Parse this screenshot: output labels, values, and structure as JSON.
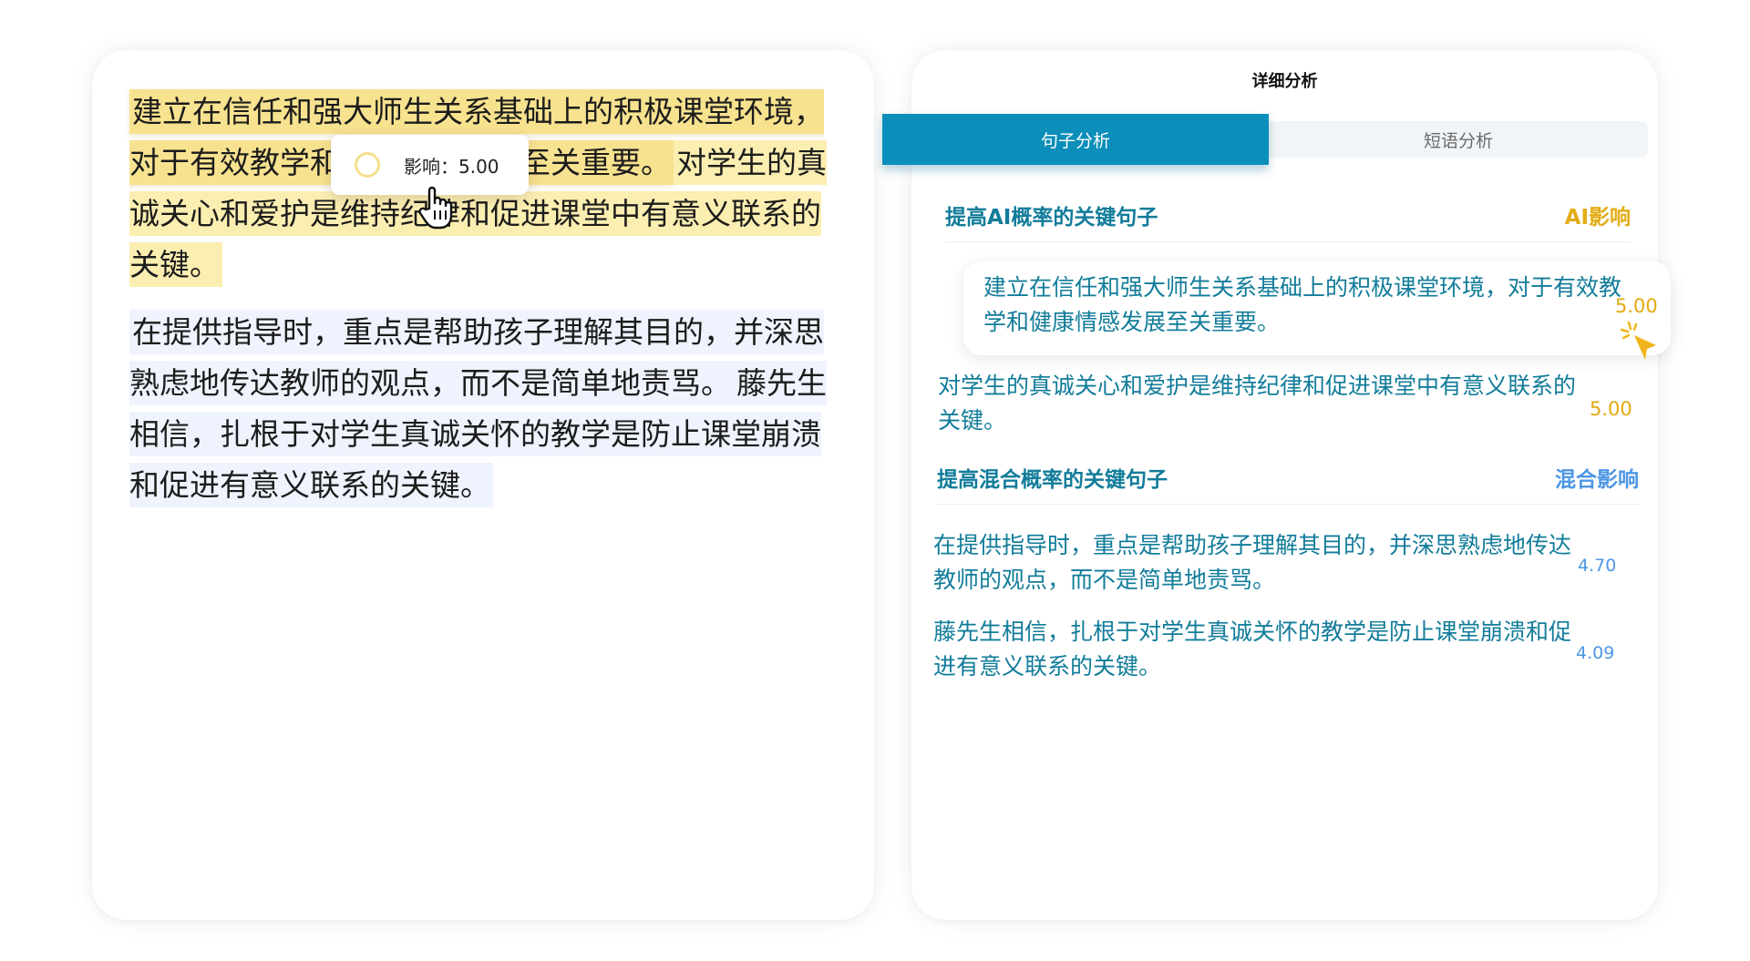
{
  "document": {
    "para1": {
      "s1_part1": "建立在信任和强大师生关系基础上的积极课堂环境，对于有效教",
      "s1_part2": "学和健康情",
      "s1_part3": "感发展至关重要。",
      "s2_part1": "对学生的真诚关心和爱",
      "s2_part2": "护是维持纪律和促进课堂中有意义联系的关键。"
    },
    "para2": {
      "s1": "在提供指导时，重点是帮助孩子理解其目的，并深思熟虑地传达教师的观点，而不是简单地责骂。",
      "s2": "藤先生相信，扎根于对学生真诚关怀的教学是防止课堂崩溃和促进有意义联系的关键。"
    }
  },
  "tooltip": {
    "text": "影响：5.00"
  },
  "panel": {
    "title": "详细分析",
    "tabs": {
      "sentence": "句子分析",
      "phrase": "短语分析"
    },
    "ai_section": {
      "title": "提高AI概率的关键句子",
      "impact_label": "AI影响",
      "items": [
        {
          "text": "建立在信任和强大师生关系基础上的积极课堂环境，对于有效教学和健康情感发展至关重要。",
          "score": "5.00"
        },
        {
          "text": "对学生的真诚关心和爱护是维持纪律和促进课堂中有意义联系的关键。",
          "score": "5.00"
        }
      ]
    },
    "mixed_section": {
      "title": "提高混合概率的关键句子",
      "impact_label": "混合影响",
      "items": [
        {
          "text": "在提供指导时，重点是帮助孩子理解其目的，并深思熟虑地传达教师的观点，而不是简单地责骂。",
          "score": "4.70"
        },
        {
          "text": "藤先生相信，扎根于对学生真诚关怀的教学是防止课堂崩溃和促进有意义联系的关键。",
          "score": "4.09"
        }
      ]
    }
  },
  "colors": {
    "tab_active": "#0b8eb9",
    "teal_text": "#127c9a",
    "ai_gold": "#e3ac15",
    "mixed_blue": "#4e97e3",
    "highlight_yellow": "#fbeeb1",
    "highlight_blue": "#eef3fd"
  },
  "icons": {
    "hover_cursor": "hand-pointer-icon",
    "click_cursor": "arrow-cursor-icon"
  }
}
